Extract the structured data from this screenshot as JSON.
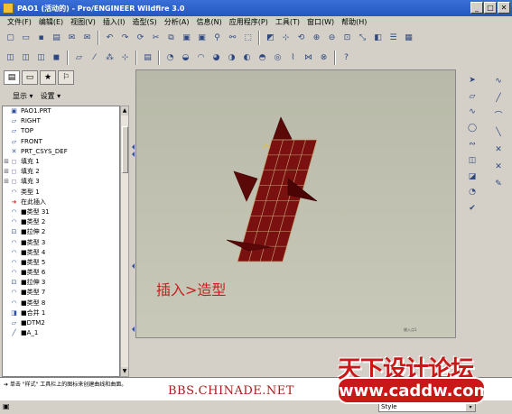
{
  "window": {
    "title": "PAO1 (活动的) - Pro/ENGINEER Wildfire 3.0",
    "min_label": "_",
    "max_label": "□",
    "close_label": "✕"
  },
  "menubar": [
    "文件(F)",
    "编辑(E)",
    "视图(V)",
    "插入(I)",
    "造型(S)",
    "分析(A)",
    "信息(N)",
    "应用程序(P)",
    "工具(T)",
    "窗口(W)",
    "帮助(H)"
  ],
  "left_panel": {
    "show_label": "显示",
    "settings_label": "设置",
    "dropdown_arrow": "▾",
    "tree": [
      {
        "label": "PAO1.PRT",
        "icon": "part-icon",
        "glyph": "▣",
        "exp": ""
      },
      {
        "label": "RIGHT",
        "icon": "datum-plane-icon",
        "glyph": "▱",
        "exp": ""
      },
      {
        "label": "TOP",
        "icon": "datum-plane-icon",
        "glyph": "▱",
        "exp": ""
      },
      {
        "label": "FRONT",
        "icon": "datum-plane-icon",
        "glyph": "▱",
        "exp": ""
      },
      {
        "label": "PRT_CSYS_DEF",
        "icon": "csys-icon",
        "glyph": "✕",
        "exp": ""
      },
      {
        "label": "填充 1",
        "icon": "fill-icon",
        "glyph": "◻",
        "exp": "⊞"
      },
      {
        "label": "填充 2",
        "icon": "fill-icon",
        "glyph": "◻",
        "exp": "⊞"
      },
      {
        "label": "填充 3",
        "icon": "fill-icon",
        "glyph": "◻",
        "exp": "⊞"
      },
      {
        "label": "类型 1",
        "icon": "style-icon",
        "glyph": "◠",
        "exp": ""
      },
      {
        "label": "在此插入",
        "icon": "insert-here-icon",
        "glyph": "➔",
        "exp": ""
      },
      {
        "label": "■类型 31",
        "icon": "style-icon",
        "glyph": "◠",
        "exp": ""
      },
      {
        "label": "■类型 2",
        "icon": "style-icon",
        "glyph": "◠",
        "exp": ""
      },
      {
        "label": "■拉伸 2",
        "icon": "extrude-icon",
        "glyph": "⊡",
        "exp": ""
      },
      {
        "label": "■类型 3",
        "icon": "style-icon",
        "glyph": "◠",
        "exp": ""
      },
      {
        "label": "■类型 4",
        "icon": "style-icon",
        "glyph": "◠",
        "exp": ""
      },
      {
        "label": "■类型 5",
        "icon": "style-icon",
        "glyph": "◠",
        "exp": ""
      },
      {
        "label": "■类型 6",
        "icon": "style-icon",
        "glyph": "◠",
        "exp": ""
      },
      {
        "label": "■拉伸 3",
        "icon": "extrude-icon",
        "glyph": "⊡",
        "exp": ""
      },
      {
        "label": "■类型 7",
        "icon": "style-icon",
        "glyph": "◠",
        "exp": ""
      },
      {
        "label": "■类型 8",
        "icon": "style-icon",
        "glyph": "◠",
        "exp": ""
      },
      {
        "label": "■合并 1",
        "icon": "merge-icon",
        "glyph": "◨",
        "exp": ""
      },
      {
        "label": "■DTM2",
        "icon": "datum-plane-icon",
        "glyph": "▱",
        "exp": ""
      },
      {
        "label": "■A_1",
        "icon": "axis-icon",
        "glyph": "╱",
        "exp": ""
      }
    ]
  },
  "graphics": {
    "annotation": "插入>造型",
    "small_label": "输入点1"
  },
  "status": {
    "message": "单击 \"样式\" 工具栏上的图标来创建曲线和曲面。",
    "style_value": "Style",
    "style_arrow": "▾"
  },
  "watermark": {
    "bbs": "BBS.CHINADE.NET",
    "forum": "天下设计论坛",
    "url": "www.caddw.com"
  },
  "colors": {
    "surface_fill": "#7a1010",
    "surface_edge": "#c8a878",
    "annotation": "#c82020",
    "watermark": "#c81818"
  }
}
